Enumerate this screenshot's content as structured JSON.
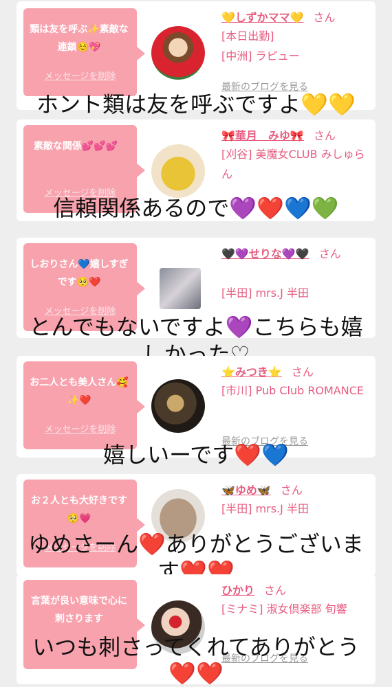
{
  "delete_label": "メッセージを削除",
  "blog_label": "最新のブログを見る",
  "san": "さん",
  "cards": [
    {
      "message": "類は友を呼ぶ✨素敵な連鎖☺️💖",
      "name": "💛しずかママ💛",
      "meta1": "[本日出勤]",
      "meta2": "[中洲] ラピュー",
      "caption": "ホント類は友を呼ぶですよ💛💛"
    },
    {
      "message": "素敵な関係💕💕💕",
      "name": "🎀華月　みゆ🎀",
      "meta1": "[刈谷] 美魔女CLUB みしゅらん",
      "meta2": "",
      "caption": "信頼関係あるので💜❤️💙💚"
    },
    {
      "message": "しおりさん💙嬉しすぎです🥺❤️",
      "name": "🖤💜せりな💜🖤",
      "meta1": "[半田] mrs.J 半田",
      "meta2": "",
      "caption": "とんでもないですよ💜こちらも嬉",
      "caption2": "しかった♡"
    },
    {
      "message": "お二人とも美人さん🥰✨❤️",
      "name": "⭐️みつき⭐️",
      "meta1": "[市川] Pub Club ROMANCE",
      "meta2": "",
      "caption": "嬉しいーです❤️💙"
    },
    {
      "message": "お２人とも大好きです🥺💗",
      "name": "🦋ゆめ🦋",
      "meta1": "[半田] mrs.J 半田",
      "meta2": "",
      "caption": "ゆめさーん❤️ありがとうございま",
      "caption2": "す❤️❤️"
    },
    {
      "message": "言葉が良い意味で心に刺さります",
      "name": "ひかり",
      "meta1": "[ミナミ] 淑女倶楽部 旬響",
      "meta2": "",
      "caption": "いつも刺さってくれてありがとう",
      "caption2": "❤️❤️"
    }
  ]
}
